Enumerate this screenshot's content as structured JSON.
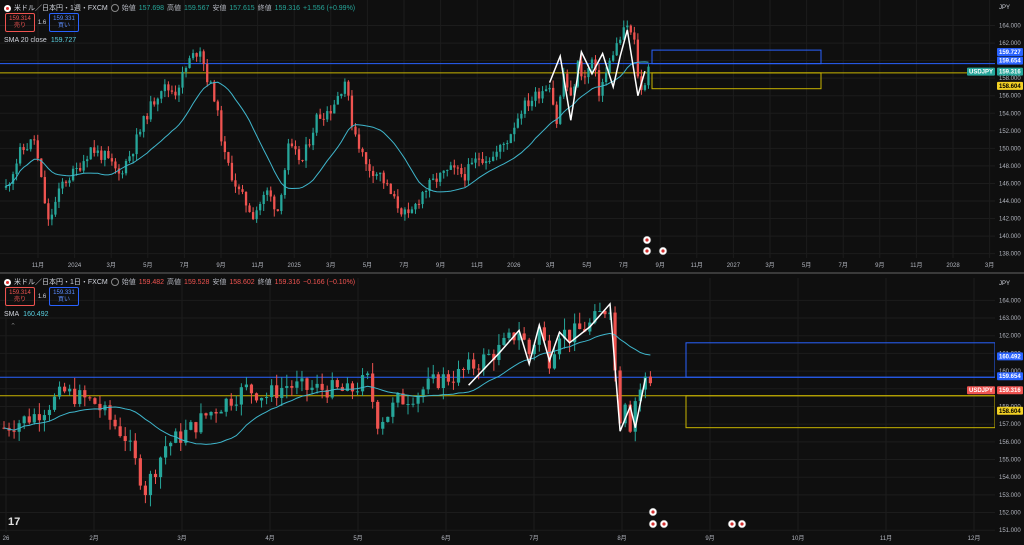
{
  "top": {
    "title": "米ドル／日本円・1週・FXCM",
    "ohlc": [
      {
        "label": "始値",
        "value": "157.698"
      },
      {
        "label": "高値",
        "value": "159.567"
      },
      {
        "label": "安値",
        "value": "157.615"
      },
      {
        "label": "終値",
        "value": "159.316"
      }
    ],
    "change": "+1.556 (+0.99%)",
    "sell_price": "159.314",
    "sell_label": "売り",
    "spread": "1.6",
    "buy_price": "159.331",
    "buy_label": "買い",
    "sma_label": "SMA 20 close",
    "sma_value": "159.727",
    "currency": "JPY",
    "price_ticks": [
      "164.000",
      "162.000",
      "160.000",
      "158.000",
      "156.000",
      "154.000",
      "152.000",
      "150.000",
      "148.000",
      "146.000",
      "144.000",
      "142.000",
      "140.000",
      "138.000"
    ],
    "time_labels": [
      "11月",
      "2024",
      "3月",
      "5月",
      "7月",
      "9月",
      "11月",
      "2025",
      "3月",
      "5月",
      "7月",
      "9月",
      "11月",
      "2026",
      "3月",
      "5月",
      "7月",
      "9月",
      "11月",
      "2027",
      "3月",
      "5月",
      "7月",
      "9月",
      "11月",
      "2028",
      "3月"
    ],
    "tags": [
      {
        "text": "159.727",
        "bg": "#2962ff",
        "color": "#ffffff",
        "price": 159.727
      },
      {
        "text": "159.654",
        "bg": "#2962ff",
        "color": "#ffffff",
        "price": 159.654
      },
      {
        "text": "159.316",
        "bg": "#26a69a",
        "color": "#ffffff",
        "price": 159.316,
        "symbol": "USDJPY"
      },
      {
        "text": "158.604",
        "bg": "#f2d024",
        "color": "#000000",
        "price": 158.604
      }
    ]
  },
  "bottom": {
    "title": "米ドル／日本円・1日・FXCM",
    "ohlc": [
      {
        "label": "始値",
        "value": "159.482"
      },
      {
        "label": "高値",
        "value": "159.528"
      },
      {
        "label": "安値",
        "value": "158.602"
      },
      {
        "label": "終値",
        "value": "159.316"
      }
    ],
    "change": "−0.166 (−0.10%)",
    "sell_price": "159.314",
    "sell_label": "売り",
    "spread": "1.6",
    "buy_price": "159.331",
    "buy_label": "買い",
    "sma_label": "SMA",
    "sma_value": "160.492",
    "currency": "JPY",
    "price_ticks": [
      "164.000",
      "163.000",
      "162.000",
      "161.000",
      "160.000",
      "159.000",
      "158.000",
      "157.000",
      "156.000",
      "155.000",
      "154.000",
      "153.000",
      "152.000",
      "151.000"
    ],
    "time_labels": [
      "26",
      "2月",
      "3月",
      "4月",
      "5月",
      "6月",
      "7月",
      "8月",
      "9月",
      "10月",
      "11月",
      "12月"
    ],
    "tags": [
      {
        "text": "160.492",
        "bg": "#2962ff",
        "color": "#ffffff",
        "price": 160.492
      },
      {
        "text": "159.654",
        "bg": "#2962ff",
        "color": "#ffffff",
        "price": 159.654
      },
      {
        "text": "159.316",
        "bg": "#ef5350",
        "color": "#ffffff",
        "price": 159.316,
        "symbol": "USDJPY"
      },
      {
        "text": "158.604",
        "bg": "#f2d024",
        "color": "#000000",
        "price": 158.604
      }
    ]
  },
  "colors": {
    "up": "#26a69a",
    "down": "#ef5350",
    "sma": "#3fb6cc",
    "zigzag": "#ffffff",
    "blue_line": "#2962ff",
    "yellow_line": "#c8b400"
  },
  "chart_data": [
    {
      "type": "candlestick",
      "timeframe": "1W",
      "symbol": "USDJPY",
      "ylim": [
        137.5,
        166.0
      ],
      "last_close": 159.316,
      "horizontal_levels": [
        159.654,
        158.604
      ],
      "zones": [
        {
          "color": "#2962ff",
          "ylim": [
            159.654,
            161.2
          ]
        },
        {
          "color": "#c8b400",
          "ylim": [
            156.8,
            158.604
          ]
        }
      ],
      "series": [
        {
          "name": "SMA 20 close",
          "last": 159.727
        }
      ],
      "close_path": [
        [
          0,
          145.5
        ],
        [
          4,
          149.5
        ],
        [
          8,
          151.0
        ],
        [
          12,
          141.5
        ],
        [
          16,
          146.0
        ],
        [
          20,
          147.5
        ],
        [
          24,
          150.0
        ],
        [
          28,
          149.0
        ],
        [
          32,
          147.0
        ],
        [
          36,
          150.0
        ],
        [
          40,
          154.0
        ],
        [
          44,
          157.0
        ],
        [
          48,
          156.5
        ],
        [
          52,
          160.0
        ],
        [
          55,
          161.5
        ],
        [
          57,
          158.0
        ],
        [
          59,
          156.0
        ],
        [
          62,
          149.0
        ],
        [
          66,
          145.0
        ],
        [
          70,
          142.5
        ],
        [
          74,
          145.0
        ],
        [
          77,
          143.0
        ],
        [
          80,
          150.0
        ],
        [
          84,
          148.5
        ],
        [
          88,
          153.5
        ],
        [
          92,
          154.5
        ],
        [
          94,
          156.0
        ],
        [
          96,
          157.8
        ],
        [
          98,
          153.0
        ],
        [
          102,
          148.0
        ],
        [
          106,
          147.0
        ],
        [
          110,
          144.0
        ],
        [
          114,
          142.0
        ],
        [
          118,
          145.0
        ],
        [
          122,
          146.5
        ],
        [
          126,
          147.5
        ],
        [
          130,
          147.0
        ],
        [
          134,
          149.0
        ],
        [
          138,
          149.0
        ],
        [
          142,
          151.0
        ],
        [
          146,
          154.5
        ],
        [
          150,
          156.0
        ],
        [
          154,
          157.5
        ],
        [
          156,
          153.0
        ],
        [
          158,
          158.5
        ],
        [
          160,
          155.5
        ],
        [
          162,
          159.5
        ],
        [
          164,
          158.0
        ],
        [
          166,
          160.0
        ],
        [
          168,
          156.5
        ],
        [
          170,
          158.5
        ],
        [
          172,
          161.0
        ],
        [
          174,
          162.5
        ],
        [
          176,
          164.0
        ],
        [
          178,
          162.0
        ],
        [
          179,
          158.5
        ],
        [
          180,
          156.5
        ],
        [
          181,
          157.7
        ],
        [
          182,
          159.3
        ]
      ]
    },
    {
      "type": "candlestick",
      "timeframe": "1D",
      "symbol": "USDJPY",
      "ylim": [
        150.9,
        164.7
      ],
      "last_close": 159.316,
      "horizontal_levels": [
        159.654,
        158.604
      ],
      "zones": [
        {
          "color": "#2962ff",
          "ylim": [
            159.654,
            161.6
          ]
        },
        {
          "color": "#c8b400",
          "ylim": [
            156.8,
            158.604
          ]
        }
      ],
      "series": [
        {
          "name": "SMA",
          "last": 160.492
        }
      ],
      "close_path": [
        [
          0,
          156.8
        ],
        [
          6,
          157.5
        ],
        [
          12,
          158.8
        ],
        [
          18,
          158.2
        ],
        [
          24,
          156.3
        ],
        [
          28,
          153.3
        ],
        [
          32,
          155.8
        ],
        [
          36,
          156.5
        ],
        [
          40,
          157.5
        ],
        [
          44,
          158.3
        ],
        [
          48,
          159.0
        ],
        [
          52,
          158.6
        ],
        [
          56,
          159.2
        ],
        [
          60,
          159.0
        ],
        [
          64,
          159.0
        ],
        [
          68,
          158.8
        ],
        [
          72,
          159.5
        ],
        [
          74,
          157.2
        ],
        [
          76,
          157.6
        ],
        [
          78,
          158.3
        ],
        [
          82,
          158.8
        ],
        [
          86,
          159.5
        ],
        [
          90,
          159.8
        ],
        [
          94,
          160.5
        ],
        [
          98,
          161.2
        ],
        [
          102,
          162.3
        ],
        [
          104,
          161.0
        ],
        [
          106,
          162.4
        ],
        [
          108,
          160.7
        ],
        [
          110,
          162.3
        ],
        [
          112,
          162.0
        ],
        [
          114,
          162.3
        ],
        [
          116,
          162.6
        ],
        [
          118,
          163.2
        ],
        [
          120,
          163.8
        ],
        [
          121,
          160.0
        ],
        [
          122,
          157.5
        ],
        [
          123,
          158.5
        ],
        [
          124,
          157.0
        ],
        [
          125,
          158.4
        ],
        [
          126,
          159.0
        ],
        [
          127,
          159.5
        ],
        [
          128,
          159.4
        ]
      ]
    }
  ]
}
